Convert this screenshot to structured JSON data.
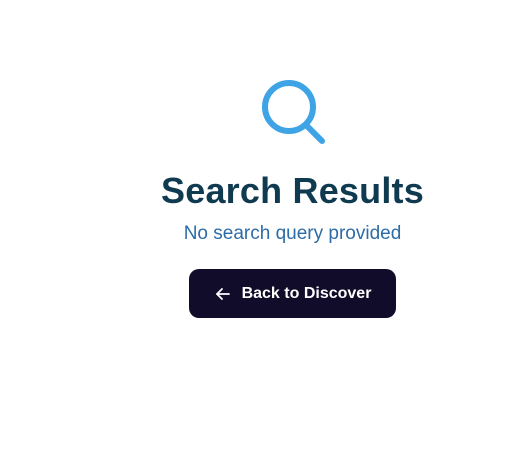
{
  "empty_state": {
    "icon": "search-icon",
    "title": "Search Results",
    "message": "No search query provided",
    "back_button": {
      "label": "Back to Discover",
      "icon": "arrow-left-icon"
    }
  },
  "colors": {
    "icon": "#3ea4e6",
    "title": "#0f3a4f",
    "message": "#2c6ca8",
    "button_bg": "#110c29",
    "button_text": "#ffffff"
  }
}
